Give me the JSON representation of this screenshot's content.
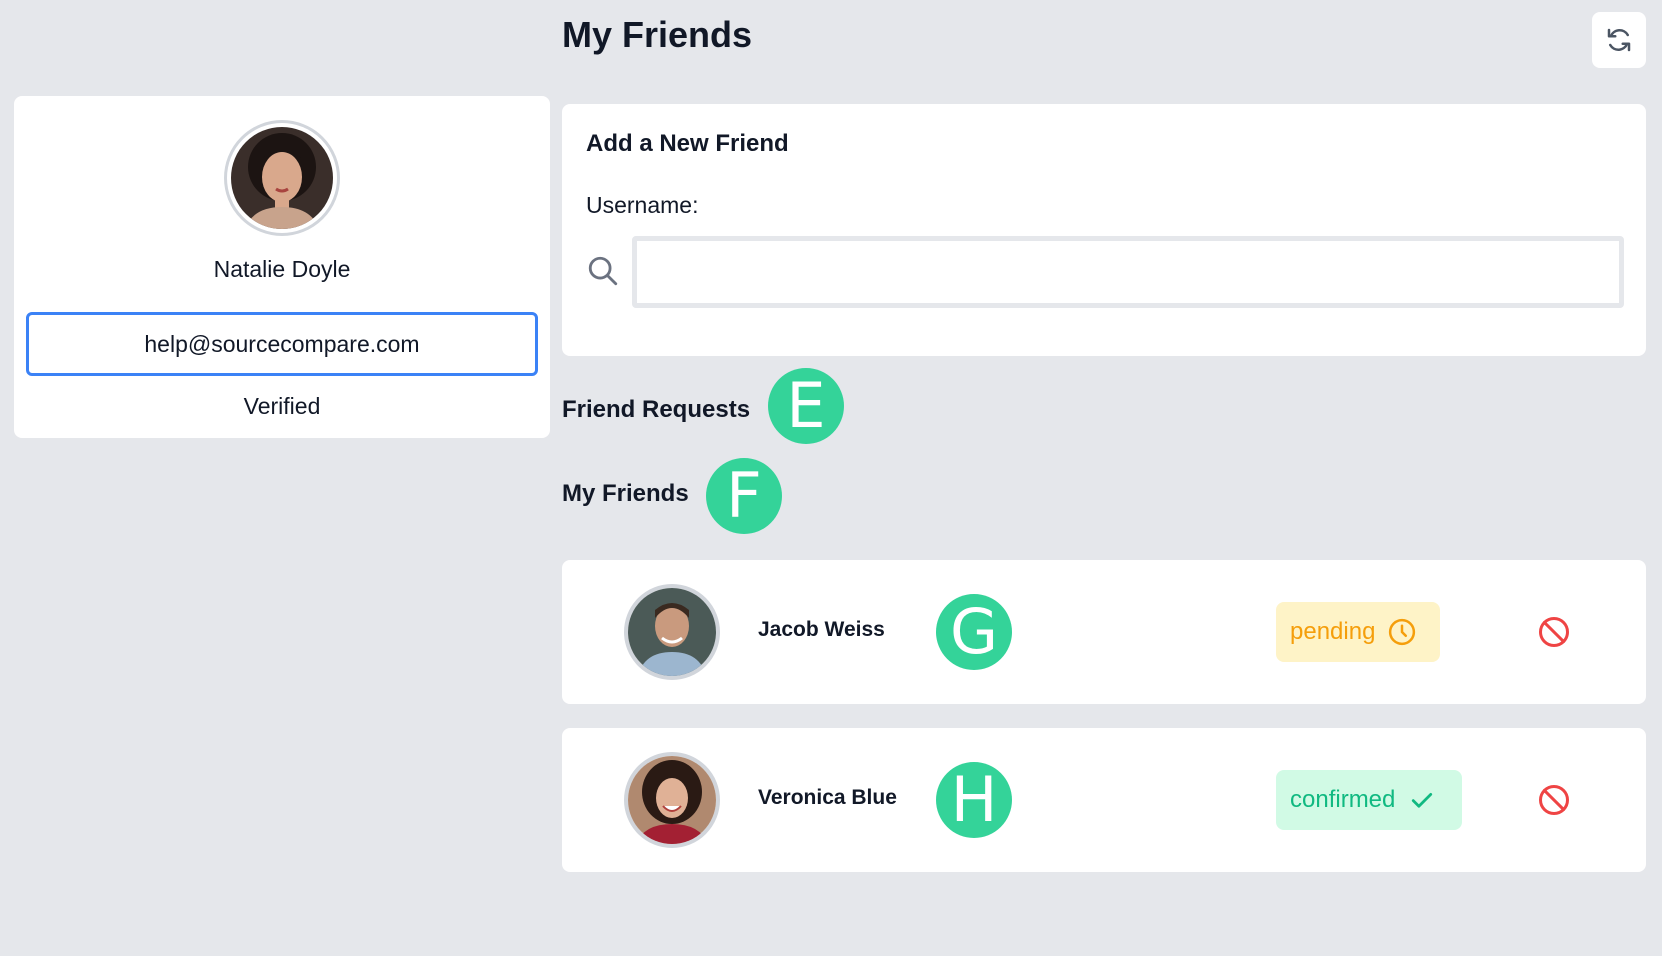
{
  "page": {
    "title": "My Friends",
    "refresh_icon": "refresh-icon"
  },
  "profile": {
    "name": "Natalie Doyle",
    "email": "help@sourcecompare.com",
    "status": "Verified"
  },
  "add_friend": {
    "title": "Add a New Friend",
    "username_label": "Username:",
    "username_value": "",
    "search_icon": "search-icon"
  },
  "sections": {
    "requests_title": "Friend Requests",
    "requests_marker": "E",
    "friends_title": "My Friends",
    "friends_marker": "F"
  },
  "friends": [
    {
      "name": "Jacob Weiss",
      "marker": "G",
      "status": "pending",
      "status_icon": "clock-icon",
      "status_color": "#f59e0b"
    },
    {
      "name": "Veronica Blue",
      "marker": "H",
      "status": "confirmed",
      "status_icon": "check-icon",
      "status_color": "#10b981"
    }
  ],
  "colors": {
    "background": "#e5e7eb",
    "accent_blue": "#3b82f6",
    "marker_green": "#34d399",
    "remove_red": "#ef4444"
  }
}
